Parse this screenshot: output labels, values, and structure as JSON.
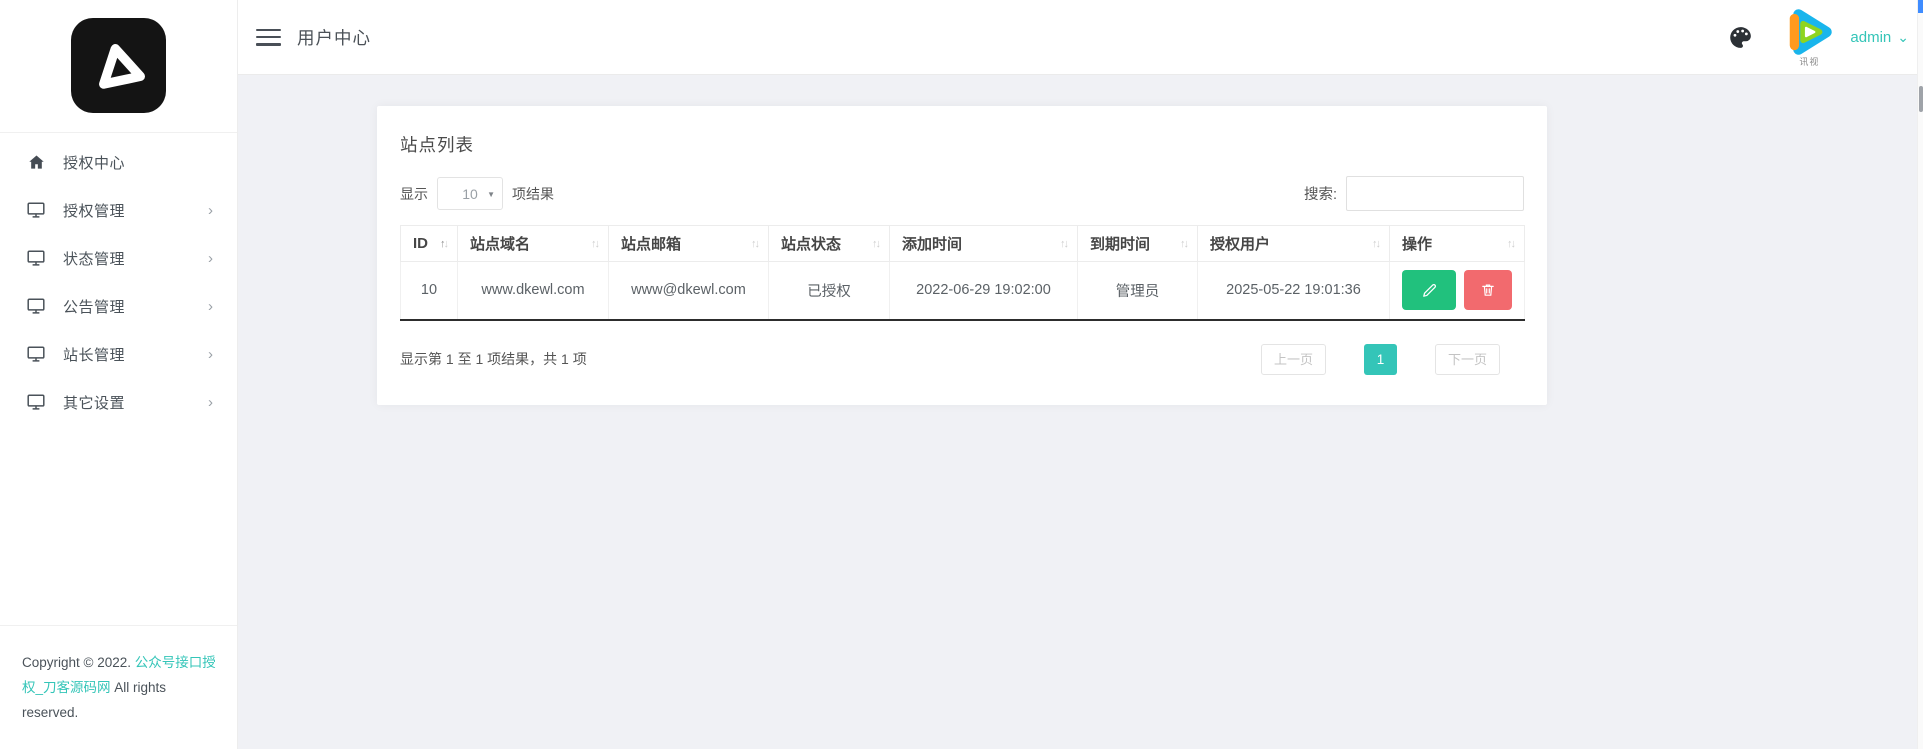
{
  "colors": {
    "accent": "#34c5b8",
    "edit": "#21c17d",
    "delete": "#f26a6e",
    "page-bg": "#f0f1f5",
    "logo-bg": "#141414"
  },
  "icons": {
    "chevron_right": "›",
    "caret_down": "▼",
    "chevron_down": "⌄",
    "sort_asc": "↑",
    "sort_desc": "↓"
  },
  "sidebar": {
    "items": [
      {
        "label": "授权中心",
        "icon": "home-icon"
      },
      {
        "label": "授权管理",
        "icon": "monitor-icon"
      },
      {
        "label": "状态管理",
        "icon": "monitor-icon"
      },
      {
        "label": "公告管理",
        "icon": "monitor-icon"
      },
      {
        "label": "站长管理",
        "icon": "monitor-icon"
      },
      {
        "label": "其它设置",
        "icon": "monitor-icon"
      }
    ],
    "copyright": {
      "prefix": "Copyright © 2022. ",
      "link": "公众号接口授权_刀客源码网",
      "suffix": " All rights reserved."
    }
  },
  "header": {
    "title": "用户中心",
    "user": "admin",
    "avatar_watermark": "讯视"
  },
  "main": {
    "card": {
      "title": "站点列表",
      "length": {
        "prefix": "显示",
        "value": "10",
        "suffix": "项结果"
      },
      "search": {
        "label": "搜索:",
        "value": "",
        "placeholder": ""
      },
      "table": {
        "columns": [
          "ID",
          "站点域名",
          "站点邮箱",
          "站点状态",
          "添加时间",
          "到期时间",
          "授权用户",
          "操作"
        ],
        "rows": [
          [
            "10",
            "www.dkewl.com",
            "www@dkewl.com",
            "已授权",
            "2022-06-29 19:02:00",
            "管理员",
            "2025-05-22 19:01:36"
          ]
        ]
      },
      "info": "显示第 1 至 1 项结果，共 1 项",
      "pagination": {
        "prev": "上一页",
        "current": "1",
        "next": "下一页"
      }
    }
  }
}
